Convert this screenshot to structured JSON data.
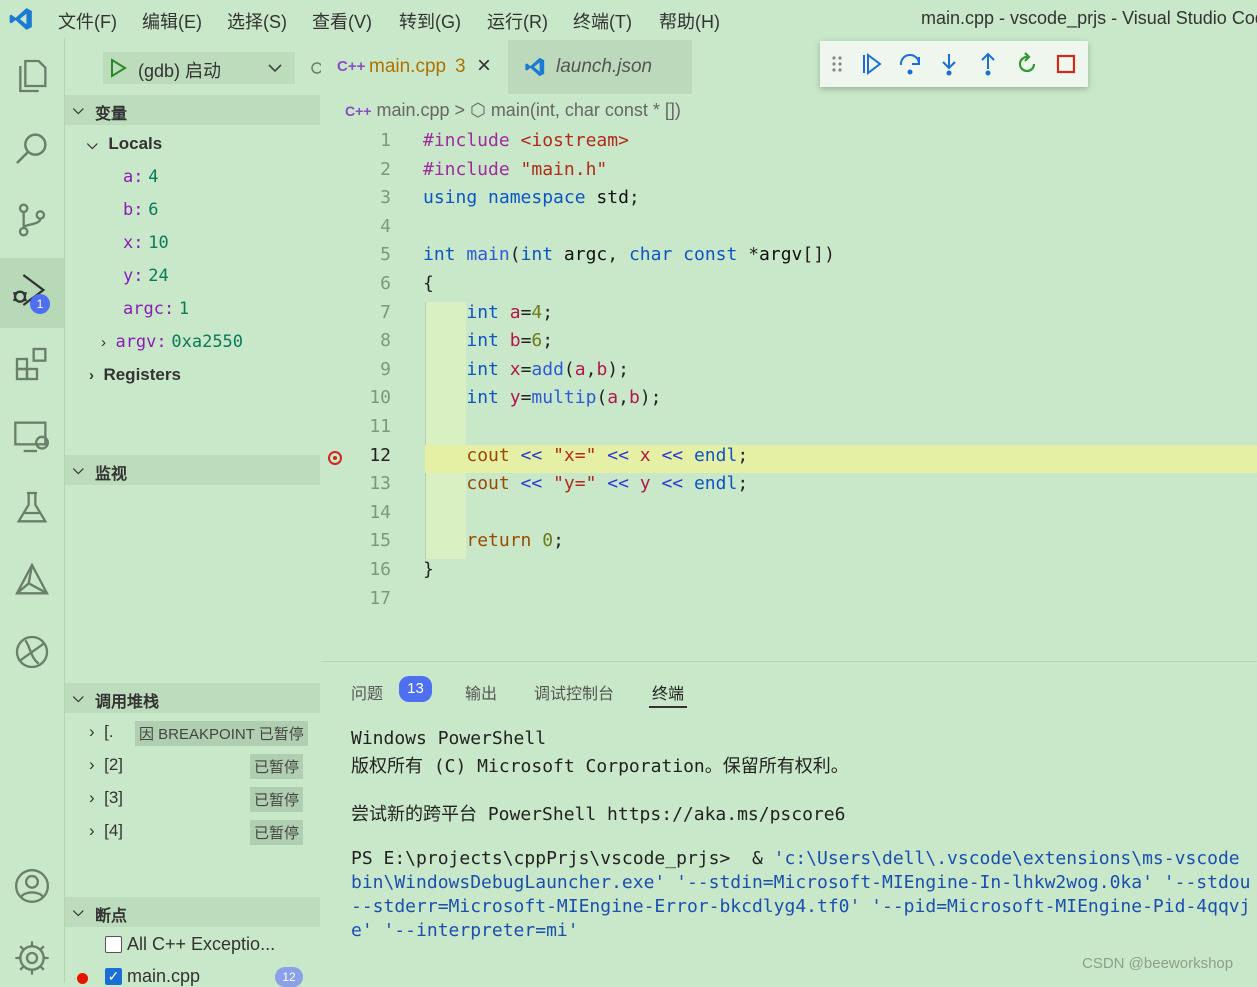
{
  "menu": [
    "文件(F)",
    "编辑(E)",
    "选择(S)",
    "查看(V)",
    "转到(G)",
    "运行(R)",
    "终端(T)",
    "帮助(H)"
  ],
  "window_title": "main.cpp - vscode_prjs - Visual Studio Cod",
  "activity_badges": {
    "debug": "1"
  },
  "sidebar": {
    "launch_config": "(gdb) 启动",
    "variables_header": "变量",
    "locals_label": "Locals",
    "locals": [
      {
        "name": "a:",
        "value": "4"
      },
      {
        "name": "b:",
        "value": "6"
      },
      {
        "name": "x:",
        "value": "10"
      },
      {
        "name": "y:",
        "value": "24"
      },
      {
        "name": "argc:",
        "value": "1"
      },
      {
        "name": "argv:",
        "value": "0xa2550"
      }
    ],
    "registers_label": "Registers",
    "watch_header": "监视",
    "callstack_header": "调用堆栈",
    "callstack": [
      {
        "label": "[.",
        "tag": "因 BREAKPOINT 已暂停"
      },
      {
        "label": "[2]",
        "tag": "已暂停"
      },
      {
        "label": "[3]",
        "tag": "已暂停"
      },
      {
        "label": "[4]",
        "tag": "已暂停"
      }
    ],
    "breakpoints_header": "断点",
    "breakpoints": [
      {
        "label": "All C++ Exceptio...",
        "checked": false
      },
      {
        "label": "main.cpp",
        "checked": true,
        "badge": "12"
      }
    ]
  },
  "tabs": [
    {
      "icon": "C++",
      "label": "main.cpp",
      "problems": "3",
      "close": "×"
    },
    {
      "label": "launch.json"
    }
  ],
  "breadcrumb": {
    "file": "main.cpp",
    "separator": ">",
    "symbol": "main(int, char const * [])"
  },
  "code": {
    "numbers": [
      "1",
      "2",
      "3",
      "4",
      "5",
      "6",
      "7",
      "8",
      "9",
      "10",
      "11",
      "12",
      "13",
      "14",
      "15",
      "16",
      "17"
    ],
    "lines": [
      [
        [
          "pp",
          "#include "
        ],
        [
          "str",
          "<iostream>"
        ]
      ],
      [
        [
          "pp",
          "#include "
        ],
        [
          "str",
          "\"main.h\""
        ]
      ],
      [
        [
          "kw",
          "using "
        ],
        [
          "kw",
          "namespace "
        ],
        [
          "id",
          "std"
        ],
        [
          "pn",
          ";"
        ]
      ],
      [],
      [
        [
          "kw",
          "int "
        ],
        [
          "fn",
          "main"
        ],
        [
          "pn",
          "("
        ],
        [
          "kw",
          "int "
        ],
        [
          "id",
          "argc"
        ],
        [
          "pn",
          ", "
        ],
        [
          "kw",
          "char const "
        ],
        [
          "pn",
          "*"
        ],
        [
          "id",
          "argv"
        ],
        [
          "pn",
          "[])"
        ]
      ],
      [
        [
          "pn",
          "{"
        ]
      ],
      [
        [
          "pn",
          "    "
        ],
        [
          "kw",
          "int "
        ],
        [
          "var",
          "a"
        ],
        [
          "pn",
          "="
        ],
        [
          "num",
          "4"
        ],
        [
          "pn",
          ";"
        ]
      ],
      [
        [
          "pn",
          "    "
        ],
        [
          "kw",
          "int "
        ],
        [
          "var",
          "b"
        ],
        [
          "pn",
          "="
        ],
        [
          "num",
          "6"
        ],
        [
          "pn",
          ";"
        ]
      ],
      [
        [
          "pn",
          "    "
        ],
        [
          "kw",
          "int "
        ],
        [
          "var",
          "x"
        ],
        [
          "pn",
          "="
        ],
        [
          "fn",
          "add"
        ],
        [
          "pn",
          "("
        ],
        [
          "var",
          "a"
        ],
        [
          "pn",
          ","
        ],
        [
          "var",
          "b"
        ],
        [
          "pn",
          ");"
        ]
      ],
      [
        [
          "pn",
          "    "
        ],
        [
          "kw",
          "int "
        ],
        [
          "var",
          "y"
        ],
        [
          "pn",
          "="
        ],
        [
          "fn",
          "multip"
        ],
        [
          "pn",
          "("
        ],
        [
          "var",
          "a"
        ],
        [
          "pn",
          ","
        ],
        [
          "var",
          "b"
        ],
        [
          "pn",
          ");"
        ]
      ],
      [],
      [
        [
          "pn",
          "    "
        ],
        [
          "tp",
          "cout "
        ],
        [
          "op",
          "<< "
        ],
        [
          "str",
          "\"x=\" "
        ],
        [
          "op",
          "<< "
        ],
        [
          "var",
          "x "
        ],
        [
          "op",
          "<< "
        ],
        [
          "kw",
          "endl"
        ],
        [
          "pn",
          ";"
        ]
      ],
      [
        [
          "pn",
          "    "
        ],
        [
          "tp",
          "cout "
        ],
        [
          "op",
          "<< "
        ],
        [
          "str",
          "\"y=\" "
        ],
        [
          "op",
          "<< "
        ],
        [
          "var",
          "y "
        ],
        [
          "op",
          "<< "
        ],
        [
          "kw",
          "endl"
        ],
        [
          "pn",
          ";"
        ]
      ],
      [],
      [
        [
          "pn",
          "    "
        ],
        [
          "tp",
          "return "
        ],
        [
          "num",
          "0"
        ],
        [
          "pn",
          ";"
        ]
      ],
      [
        [
          "pn",
          "}"
        ]
      ],
      []
    ],
    "current_line": "12"
  },
  "panel": {
    "tabs": [
      "问题",
      "输出",
      "调试控制台",
      "终端"
    ],
    "problems_count": "13",
    "active_tab": "终端",
    "terminal": [
      "Windows PowerShell",
      "版权所有 (C) Microsoft Corporation。保留所有权利。",
      "",
      "尝试新的跨平台 PowerShell https://aka.ms/pscore6",
      "",
      "PS E:\\projects\\cppPrjs\\vscode_prjs>  & 'c:\\Users\\dell\\.vscode\\extensions\\ms-vscode",
      "bin\\WindowsDebugLauncher.exe' '--stdin=Microsoft-MIEngine-In-lhkw2wog.0ka' '--stdou",
      "--stderr=Microsoft-MIEngine-Error-bkcdlyg4.tf0' '--pid=Microsoft-MIEngine-Pid-4qqvj",
      "e' '--interpreter=mi'"
    ]
  },
  "watermark": "CSDN @beeworkshop",
  "colors": {
    "accent": "#4d6ff0",
    "current_line_bg": "#e5f0a5",
    "debug_blue": "#1a6fd6",
    "stop_red": "#d0281a"
  }
}
